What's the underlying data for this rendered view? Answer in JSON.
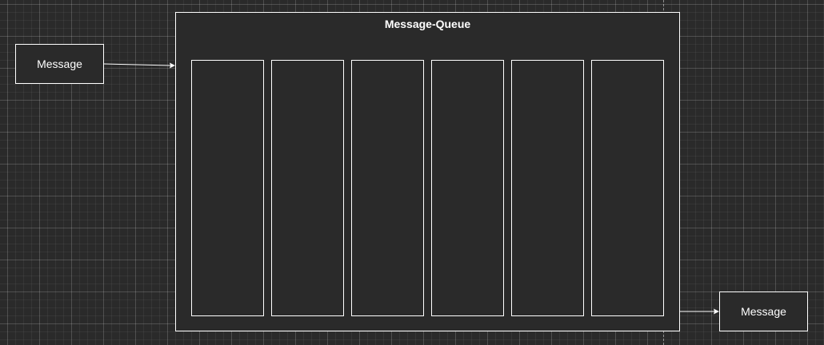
{
  "diagram": {
    "queue": {
      "title": "Message-Queue",
      "slot_count": 6
    },
    "input_node": {
      "label": "Message"
    },
    "output_node": {
      "label": "Message"
    },
    "colors": {
      "background": "#2a2a2a",
      "stroke": "#ffffff",
      "text": "#ffffff"
    }
  }
}
